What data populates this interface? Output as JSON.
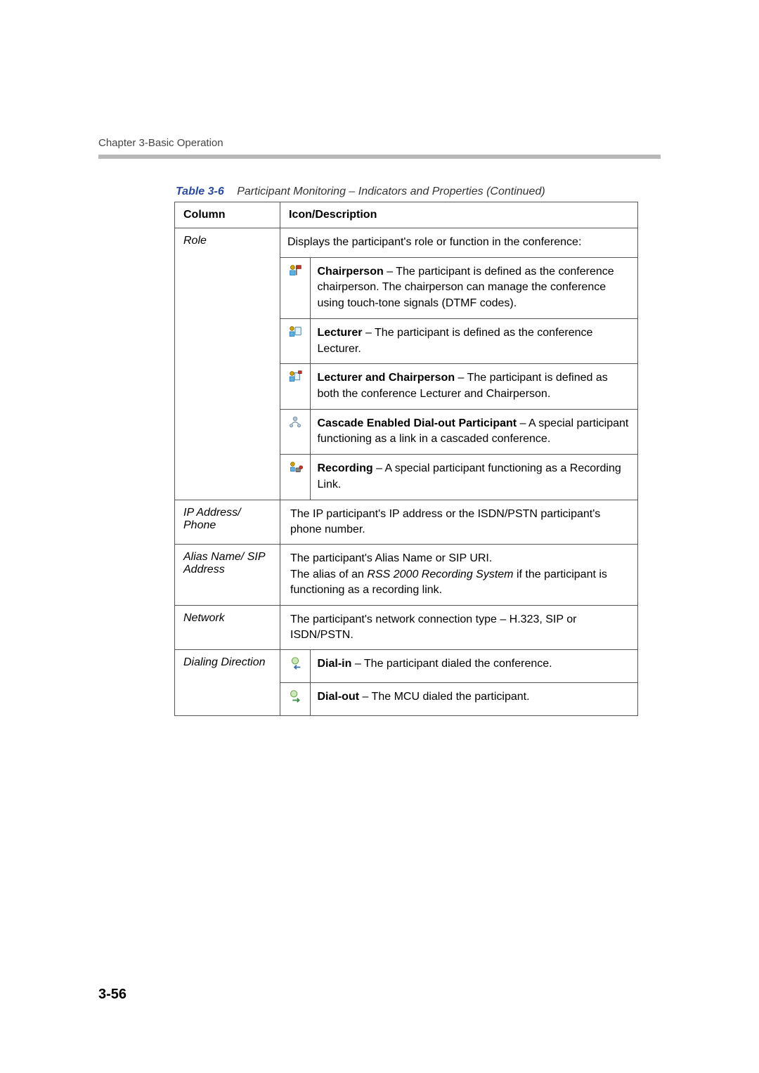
{
  "chapter": "Chapter 3-Basic Operation",
  "table": {
    "label": "Table 3-6",
    "title": "Participant Monitoring – Indicators and Properties (Continued)",
    "head": {
      "col1": "Column",
      "col2": "Icon/Description"
    },
    "rows": {
      "role": {
        "name": "Role",
        "intro": "Displays the participant's role or function in the conference:",
        "items": [
          {
            "icon": "chairperson-icon",
            "bold": "Chairperson",
            "text": " – The participant is defined as the conference chairperson. The chairperson can manage the conference using touch-tone signals (DTMF codes)."
          },
          {
            "icon": "lecturer-icon",
            "bold": "Lecturer",
            "text": " – The participant is defined as the conference Lecturer."
          },
          {
            "icon": "lecturer-chairperson-icon",
            "bold": "Lecturer and Chairperson",
            "text": " – The participant is defined as both the conference Lecturer and Chairperson."
          },
          {
            "icon": "cascade-icon",
            "bold": "Cascade Enabled Dial-out Participant",
            "text": " – A special participant functioning as a link in a cascaded conference."
          },
          {
            "icon": "recording-icon",
            "bold": "Recording",
            "text": " – A special participant functioning as a Recording Link."
          }
        ]
      },
      "ip": {
        "name": "IP Address/ Phone",
        "desc": "The IP participant's IP address or the ISDN/PSTN participant's phone number."
      },
      "alias": {
        "name": "Alias Name/ SIP Address",
        "desc_pre": "The participant's Alias Name or SIP URI.\nThe alias of an ",
        "desc_em": "RSS 2000 Recording System",
        "desc_post": " if the participant is functioning as a recording link."
      },
      "network": {
        "name": "Network",
        "desc": "The participant's network connection type – H.323, SIP or ISDN/PSTN."
      },
      "dialing": {
        "name": "Dialing Direction",
        "items": [
          {
            "icon": "dial-in-icon",
            "bold": "Dial-in",
            "text": " – The participant dialed the conference."
          },
          {
            "icon": "dial-out-icon",
            "bold": "Dial-out",
            "text": " – The MCU dialed the participant."
          }
        ]
      }
    }
  },
  "page_number": "3-56"
}
